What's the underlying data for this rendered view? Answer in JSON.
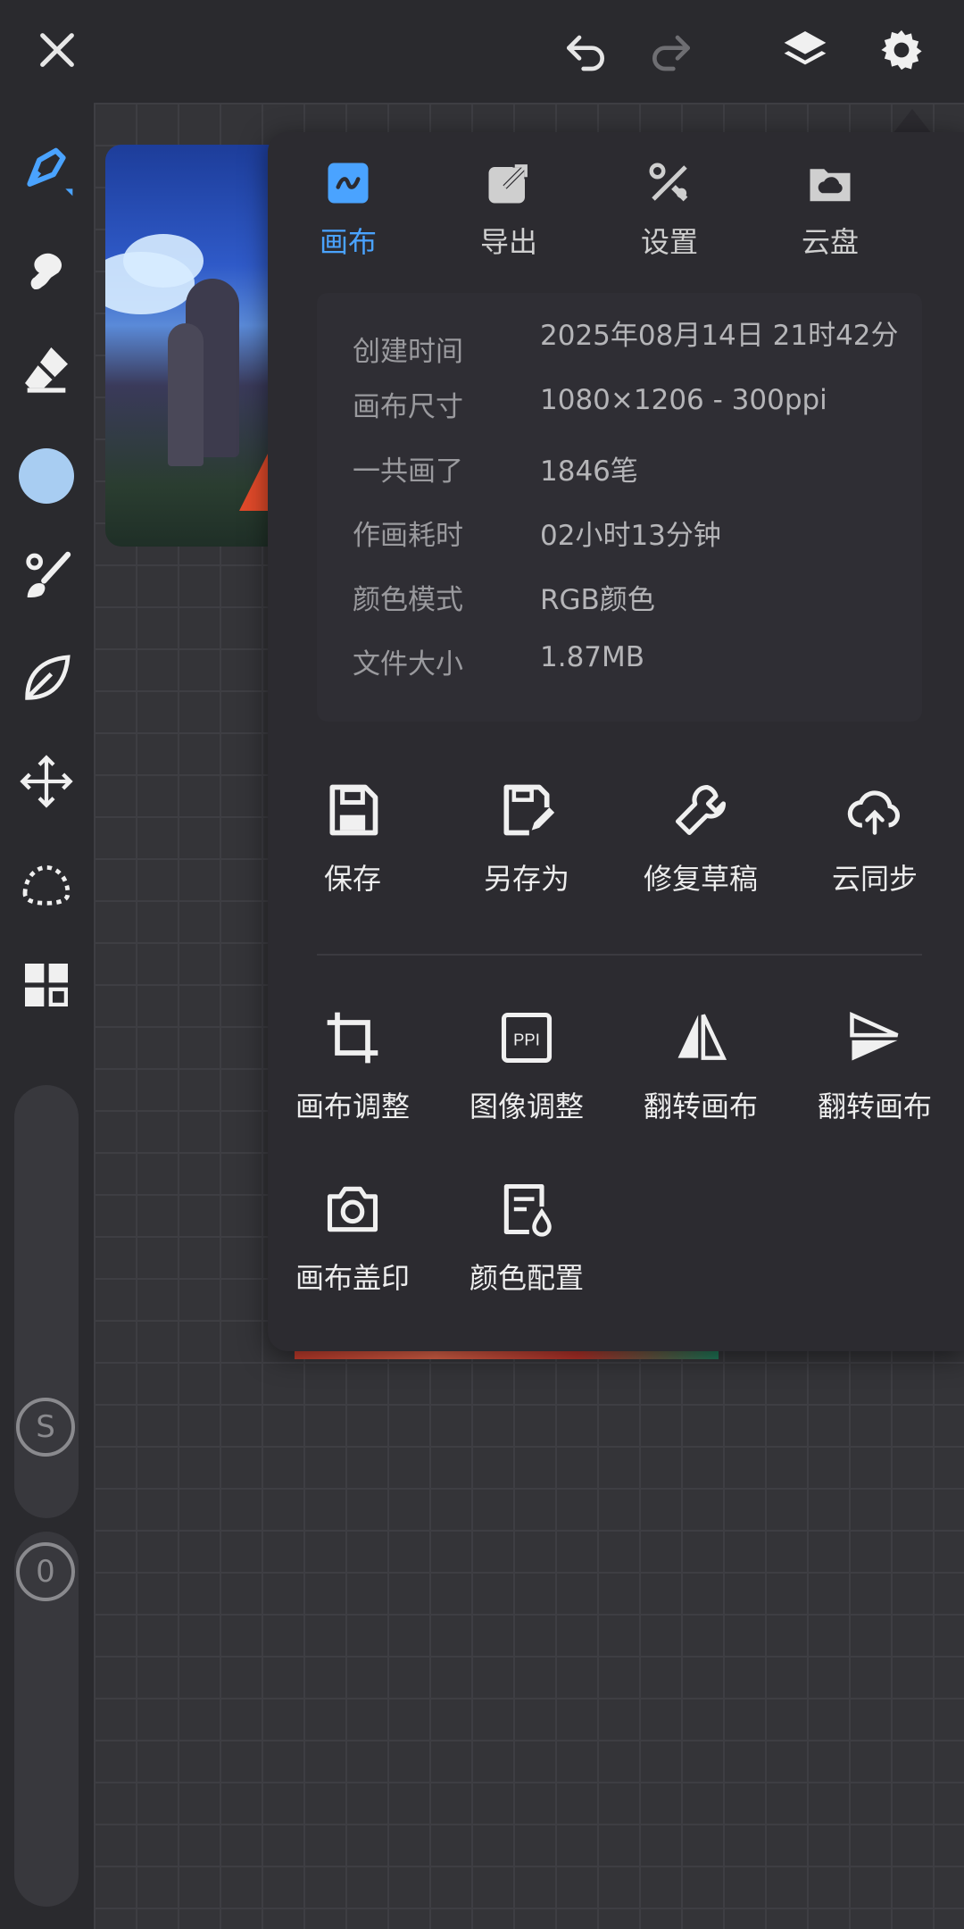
{
  "colors": {
    "accent": "#4aa3ff",
    "panel": "#2c2b30",
    "toolbar": "#2a2a2e"
  },
  "topbar": {
    "icons": [
      "close-icon",
      "undo-icon",
      "redo-icon",
      "layers-icon",
      "settings-icon"
    ]
  },
  "left_toolbar": {
    "tools": [
      "brush-icon",
      "smudge-icon",
      "eraser-icon",
      "color-swatch",
      "brush-library-icon",
      "leaf-icon",
      "move-icon",
      "lasso-icon",
      "gallery-grid-icon"
    ],
    "size_slider_label": "S",
    "opacity_slider_label": "0"
  },
  "panel": {
    "tabs": [
      {
        "label": "画布",
        "icon": "canvas-icon",
        "active": true
      },
      {
        "label": "导出",
        "icon": "export-icon",
        "active": false
      },
      {
        "label": "设置",
        "icon": "tools-icon",
        "active": false
      },
      {
        "label": "云盘",
        "icon": "cloud-folder-icon",
        "active": false
      }
    ],
    "info": [
      {
        "key": "创建时间",
        "value": "2025年08月14日 21时42分"
      },
      {
        "key": "画布尺寸",
        "value": "1080×1206 - 300ppi"
      },
      {
        "key": "一共画了",
        "value": "1846笔"
      },
      {
        "key": "作画耗时",
        "value": "02小时13分钟"
      },
      {
        "key": "颜色模式",
        "value": "RGB颜色"
      },
      {
        "key": "文件大小",
        "value": "1.87MB"
      }
    ],
    "actions_row1": [
      {
        "label": "保存",
        "icon": "save-icon"
      },
      {
        "label": "另存为",
        "icon": "save-as-icon"
      },
      {
        "label": "修复草稿",
        "icon": "wrench-icon"
      },
      {
        "label": "云同步",
        "icon": "cloud-sync-icon"
      }
    ],
    "actions_row2": [
      {
        "label": "画布调整",
        "icon": "crop-icon"
      },
      {
        "label": "图像调整",
        "icon": "ppi-icon"
      },
      {
        "label": "翻转画布",
        "icon": "flip-horizontal-icon"
      },
      {
        "label": "翻转画布",
        "icon": "flip-vertical-icon"
      }
    ],
    "actions_row3": [
      {
        "label": "画布盖印",
        "icon": "camera-icon"
      },
      {
        "label": "颜色配置",
        "icon": "color-profile-icon"
      }
    ]
  }
}
